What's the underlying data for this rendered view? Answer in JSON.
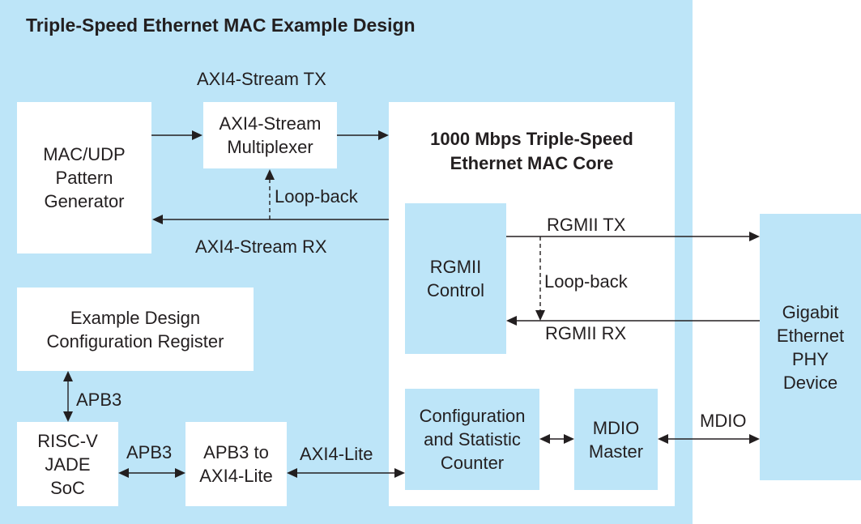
{
  "title": "Triple-Speed Ethernet MAC Example Design",
  "blocks": {
    "pattern_generator": "MAC/UDP\nPattern\nGenerator",
    "stream_mux": "AXI4-Stream\nMultiplexer",
    "mac_core": "1000 Mbps Triple-Speed\nEthernet MAC Core",
    "rgmii_control": "RGMII\nControl",
    "config_stat_counter": "Configuration\nand Statistic\nCounter",
    "mdio_master": "MDIO\nMaster",
    "phy_device": "Gigabit\nEthernet\nPHY\nDevice",
    "config_register": "Example Design\nConfiguration Register",
    "riscv_soc": "RISC-V\nJADE\nSoC",
    "apb3_to_axi4lite": "APB3 to\nAXI4-Lite"
  },
  "signals": {
    "axi_stream_tx": "AXI4-Stream TX",
    "axi_stream_rx": "AXI4-Stream RX",
    "loopback_axi": "Loop-back",
    "rgmii_tx": "RGMII TX",
    "rgmii_rx": "RGMII RX",
    "loopback_rgmii": "Loop-back",
    "mdio": "MDIO",
    "apb3_vertical": "APB3",
    "apb3_horizontal": "APB3",
    "axi4_lite": "AXI4-Lite"
  },
  "colors": {
    "panel_blue": "#bde5f8",
    "box_white": "#ffffff",
    "line": "#231f20"
  }
}
